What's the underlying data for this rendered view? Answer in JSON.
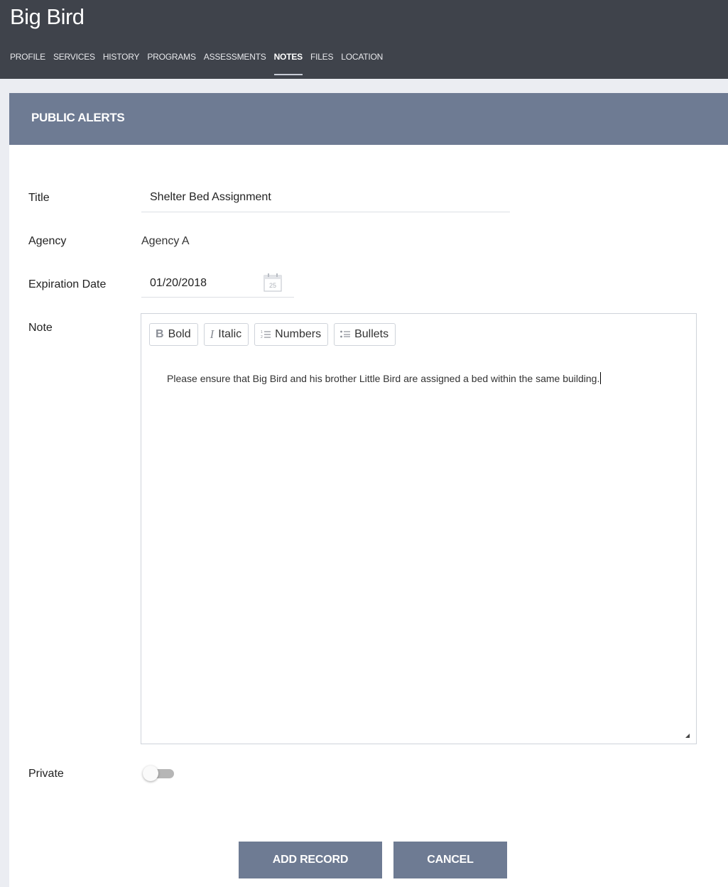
{
  "header": {
    "client_name": "Big Bird",
    "tabs": [
      {
        "label": "PROFILE",
        "active": false
      },
      {
        "label": "SERVICES",
        "active": false
      },
      {
        "label": "HISTORY",
        "active": false
      },
      {
        "label": "PROGRAMS",
        "active": false
      },
      {
        "label": "ASSESSMENTS",
        "active": false
      },
      {
        "label": "NOTES",
        "active": true
      },
      {
        "label": "FILES",
        "active": false
      },
      {
        "label": "LOCATION",
        "active": false
      }
    ]
  },
  "panel": {
    "title": "PUBLIC ALERTS"
  },
  "form": {
    "title_label": "Title",
    "title_value": "Shelter Bed Assignment",
    "agency_label": "Agency",
    "agency_value": "Agency A",
    "expiration_label": "Expiration Date",
    "expiration_value": "01/20/2018",
    "calendar_icon_day": "25",
    "note_label": "Note",
    "toolbar": {
      "bold": "Bold",
      "italic": "Italic",
      "numbers": "Numbers",
      "bullets": "Bullets"
    },
    "note_text": "Please ensure that Big Bird and his brother Little Bird are assigned a bed within the same building.",
    "private_label": "Private",
    "private_on": false
  },
  "actions": {
    "add_label": "ADD RECORD",
    "cancel_label": "CANCEL"
  },
  "colors": {
    "topbar": "#3f434b",
    "accent": "#6e7b93",
    "background": "#ebedf2"
  },
  "icons": [
    "calendar-icon",
    "bold-icon",
    "italic-icon",
    "numbered-list-icon",
    "bulleted-list-icon",
    "resize-handle-icon"
  ]
}
